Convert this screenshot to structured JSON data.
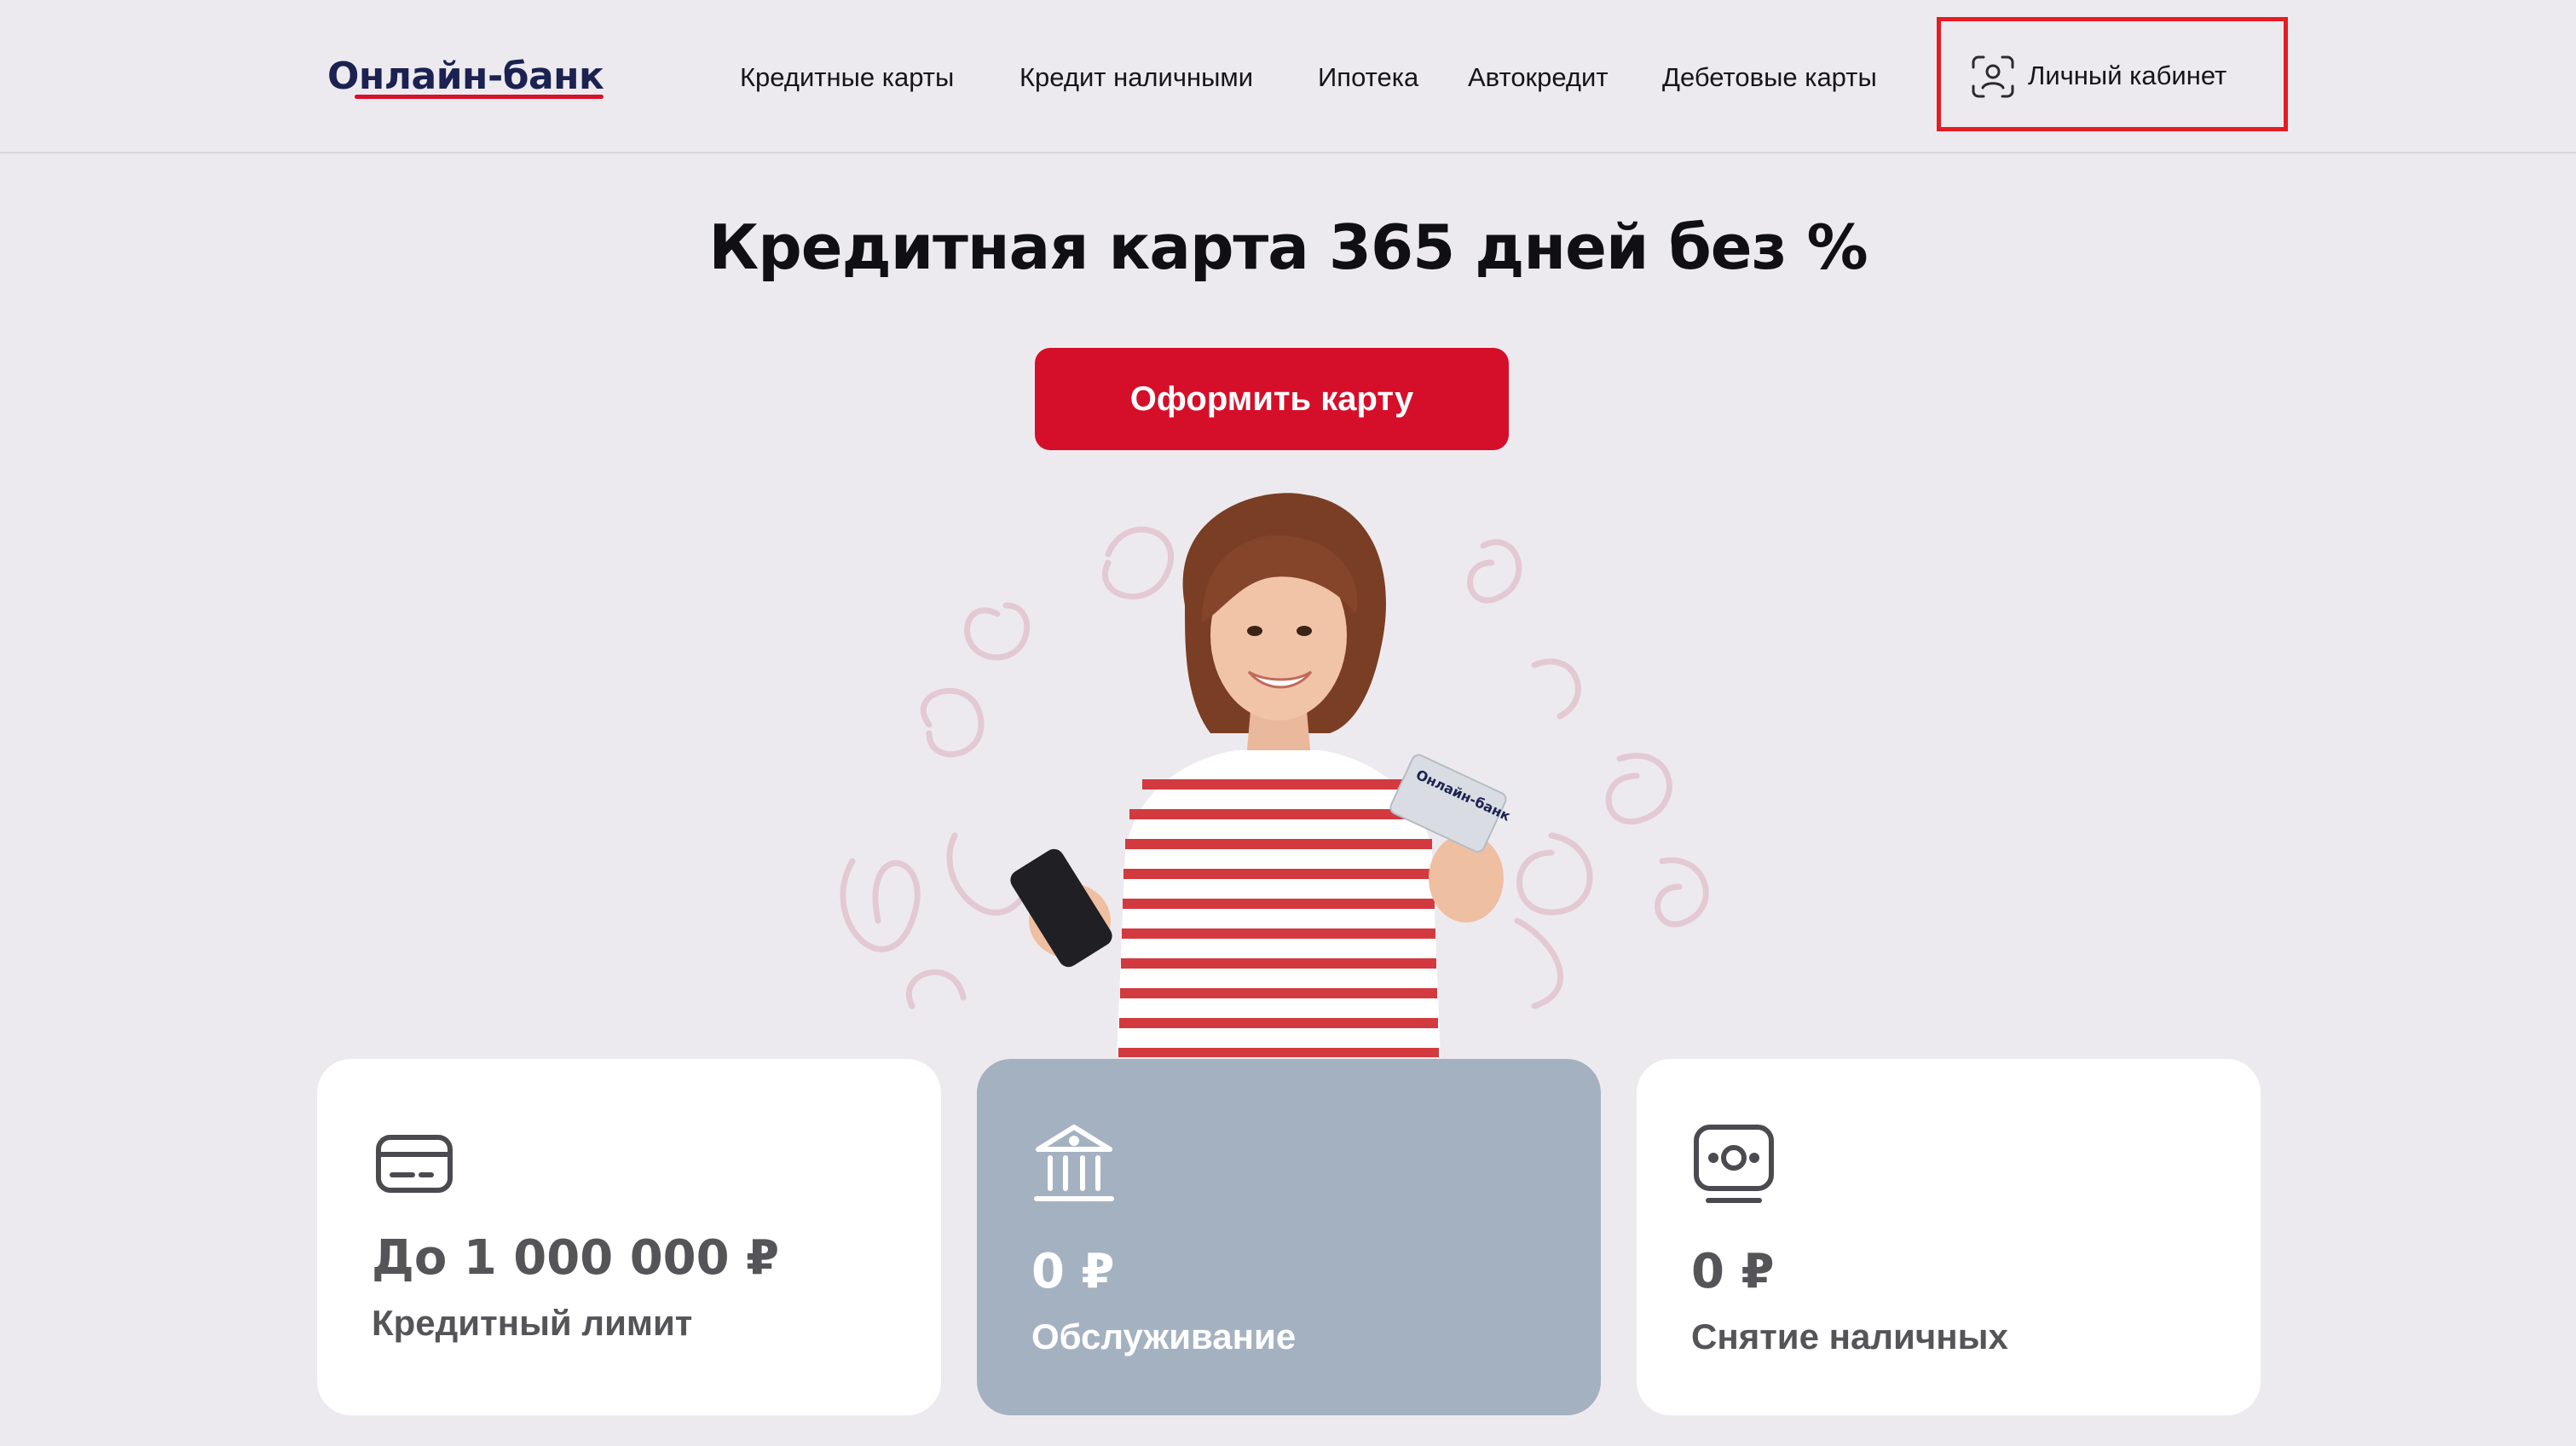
{
  "header": {
    "logo": "Онлайн-банк",
    "nav": [
      {
        "label": "Кредитные карты"
      },
      {
        "label": "Кредит наличными"
      },
      {
        "label": "Ипотека"
      },
      {
        "label": "Автокредит"
      },
      {
        "label": "Дебетовые карты"
      }
    ],
    "cabinet": {
      "label": "Личный кабинет",
      "icon": "user-face-scan-icon"
    }
  },
  "hero": {
    "title": "Кредитная карта 365 дней без %",
    "cta_label": "Оформить карту",
    "image": {
      "subject": "smiling woman in striped shirt holding phone and credit card",
      "card_text": "Онлайн-банк"
    }
  },
  "features": [
    {
      "icon": "credit-card-icon",
      "value": "До 1 000 000 ₽",
      "label": "Кредитный лимит",
      "highlighted": false
    },
    {
      "icon": "bank-building-icon",
      "value": "0 ₽",
      "label": "Обслуживание",
      "highlighted": true
    },
    {
      "icon": "cash-withdrawal-icon",
      "value": "0 ₽",
      "label": "Снятие наличных",
      "highlighted": false
    }
  ],
  "colors": {
    "background": "#edeaef",
    "brand_red": "#d50f2a",
    "brand_navy": "#1b2150",
    "highlight_card": "#a4b1c1",
    "highlight_frame": "#e51c23"
  }
}
